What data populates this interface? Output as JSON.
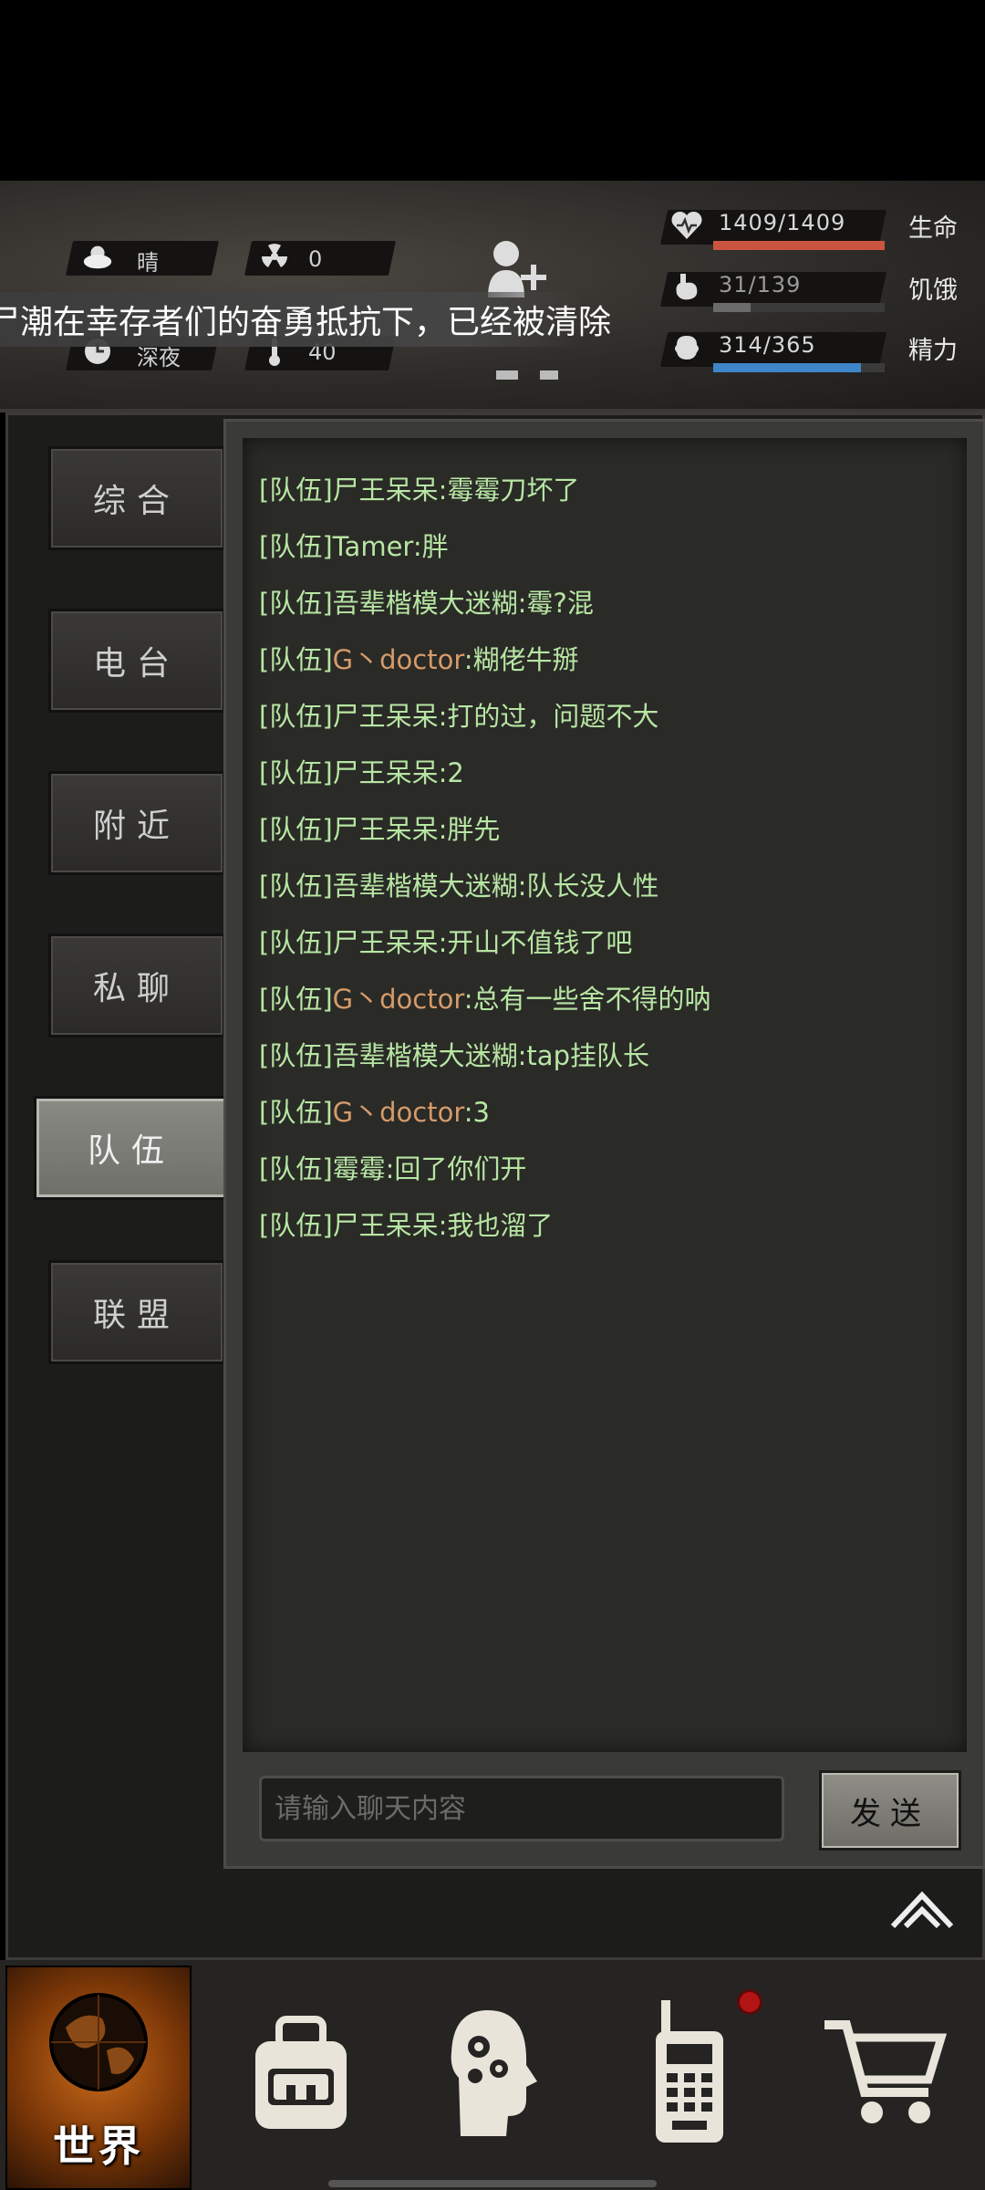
{
  "header": {
    "weather": "晴",
    "radiation": "0",
    "time_of_day": "深夜",
    "temperature": "40",
    "ticker": "尸潮在幸存者们的奋勇抵抗下，已经被清除",
    "stats": [
      {
        "label": "生命",
        "value": "1409/1409",
        "fill": 1.0,
        "color": "#c9553f"
      },
      {
        "label": "饥饿",
        "value": "31/139",
        "fill": 0.22,
        "color": "#6b6b6b"
      },
      {
        "label": "精力",
        "value": "314/365",
        "fill": 0.86,
        "color": "#3e86c7"
      }
    ]
  },
  "tabs": [
    {
      "label": "综合",
      "active": false
    },
    {
      "label": "电台",
      "active": false
    },
    {
      "label": "附近",
      "active": false
    },
    {
      "label": "私聊",
      "active": false
    },
    {
      "label": "队伍",
      "active": true
    },
    {
      "label": "联盟",
      "active": false
    }
  ],
  "chat": {
    "messages": [
      {
        "channel": "[队伍]",
        "sender": "尸王呆呆",
        "text": ":霉霉刀坏了",
        "highlight": false
      },
      {
        "channel": "[队伍]",
        "sender": "Tamer",
        "text": ":胖",
        "highlight": false
      },
      {
        "channel": "[队伍]",
        "sender": "吾辈楷模大迷糊",
        "text": ":霉?混",
        "highlight": false
      },
      {
        "channel": "[队伍]",
        "sender": "G丶doctor",
        "text": ":糊佬牛掰",
        "highlight": true
      },
      {
        "channel": "[队伍]",
        "sender": "尸王呆呆",
        "text": ":打的过，问题不大",
        "highlight": false
      },
      {
        "channel": "[队伍]",
        "sender": "尸王呆呆",
        "text": ":2",
        "highlight": false
      },
      {
        "channel": "[队伍]",
        "sender": "尸王呆呆",
        "text": ":胖先",
        "highlight": false
      },
      {
        "channel": "[队伍]",
        "sender": "吾辈楷模大迷糊",
        "text": ":队长没人性",
        "highlight": false
      },
      {
        "channel": "[队伍]",
        "sender": "尸王呆呆",
        "text": ":开山不值钱了吧",
        "highlight": false
      },
      {
        "channel": "[队伍]",
        "sender": "G丶doctor",
        "text": ":总有一些舍不得的呐",
        "highlight": true
      },
      {
        "channel": "[队伍]",
        "sender": "吾辈楷模大迷糊",
        "text": ":tap挂队长",
        "highlight": false
      },
      {
        "channel": "[队伍]",
        "sender": "G丶doctor",
        "text": ":3",
        "highlight": true
      },
      {
        "channel": "[队伍]",
        "sender": "霉霉",
        "text": ":回了你们开",
        "highlight": false
      },
      {
        "channel": "[队伍]",
        "sender": "尸王呆呆",
        "text": ":我也溜了",
        "highlight": false
      }
    ],
    "input_placeholder": "请输入聊天内容",
    "send_label": "发送"
  },
  "nav": {
    "world_label": "世界",
    "items": [
      "globe-icon",
      "backpack-icon",
      "head-gears-icon",
      "radio-icon",
      "cart-icon"
    ]
  }
}
